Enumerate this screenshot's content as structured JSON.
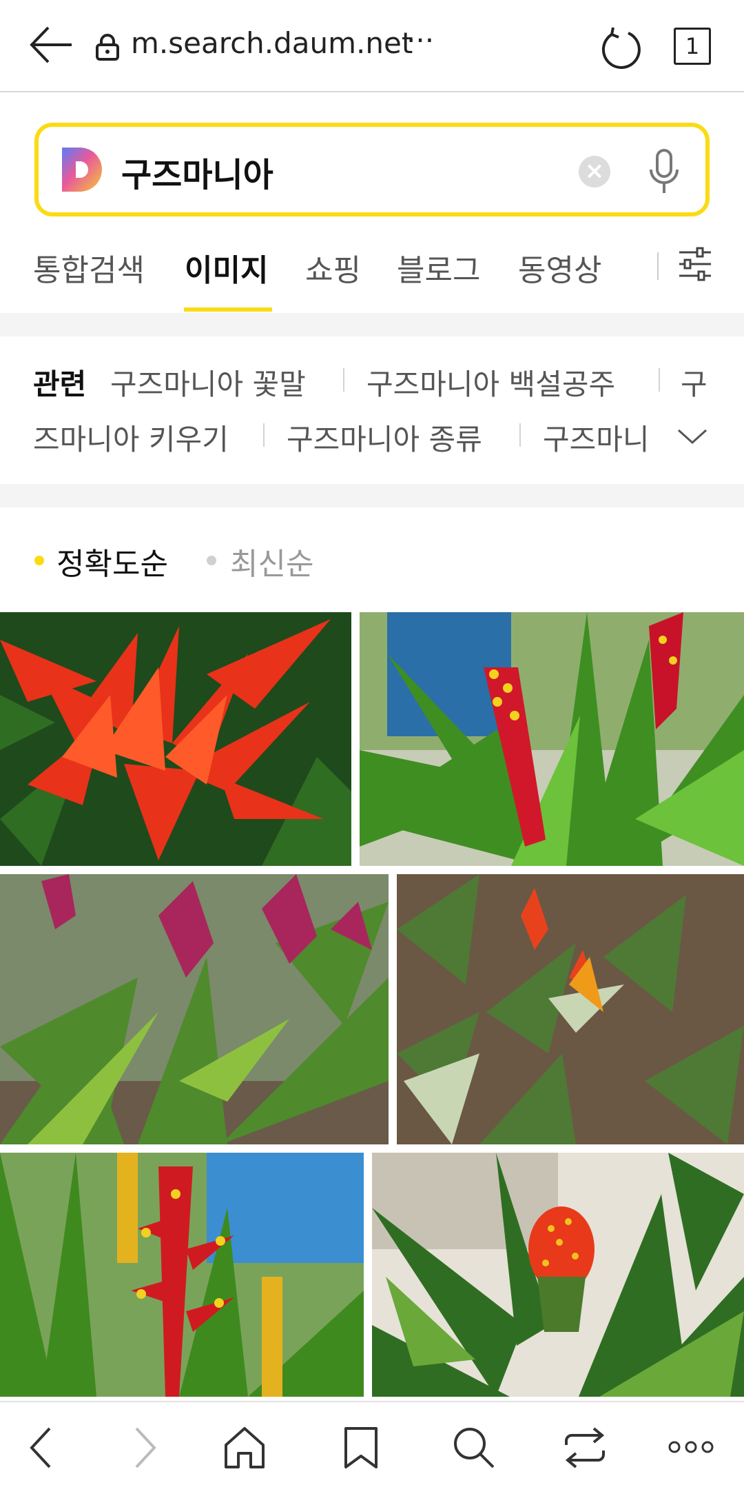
{
  "browser": {
    "url": "m.search.daum.net",
    "url_more": "···",
    "tab_count": "1"
  },
  "search": {
    "query": "구즈마니아"
  },
  "categories": [
    {
      "label": "통합검색",
      "active": false
    },
    {
      "label": "이미지",
      "active": true
    },
    {
      "label": "쇼핑",
      "active": false
    },
    {
      "label": "블로그",
      "active": false
    },
    {
      "label": "동영상",
      "active": false
    }
  ],
  "related": {
    "title": "관련",
    "line1": [
      "구즈마니아 꽃말",
      "구즈마니아 백설공주",
      "구"
    ],
    "line2": [
      "즈마니아 키우기",
      "구즈마니아 종류",
      "구즈마니"
    ]
  },
  "sort": {
    "accurate": "정확도순",
    "recent": "최신순"
  },
  "colors": {
    "accent": "#fadb14",
    "text": "#111111",
    "muted": "#999999"
  },
  "icons": {
    "back": "arrow-left",
    "lock": "lock",
    "reload": "reload",
    "mic": "microphone",
    "filter": "sliders",
    "bottom": [
      "chevron-left",
      "chevron-right",
      "home",
      "bookmark",
      "search",
      "share",
      "more"
    ]
  }
}
